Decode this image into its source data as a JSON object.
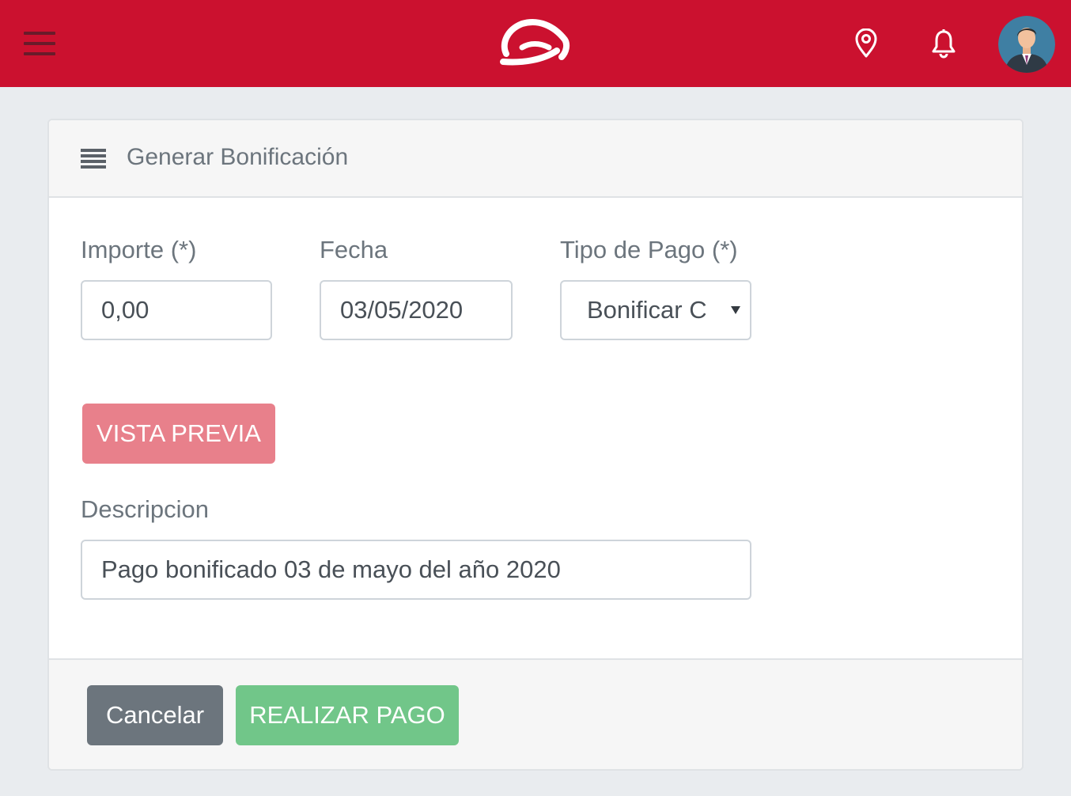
{
  "header": {
    "menu_icon": "hamburger-menu-icon",
    "logo_icon": "brand-logo",
    "location_icon": "location-pin-icon",
    "notifications_icon": "bell-icon",
    "avatar": "user-avatar",
    "colors": {
      "bar": "#cb112f"
    }
  },
  "card": {
    "title": "Generar Bonificación",
    "title_icon": "list-icon"
  },
  "form": {
    "importe": {
      "label": "Importe (*)",
      "value": "0,00"
    },
    "fecha": {
      "label": "Fecha",
      "value": "03/05/2020"
    },
    "tipo_pago": {
      "label": "Tipo de Pago (*)",
      "value": "Bonificar C"
    },
    "preview_button": "VISTA PREVIA",
    "descripcion": {
      "label": "Descripcion",
      "value": "Pago bonificado 03 de mayo del año 2020"
    }
  },
  "footer": {
    "cancel_label": "Cancelar",
    "pay_label": "REALIZAR PAGO",
    "colors": {
      "cancel": "#6c757d",
      "pay": "#71c689",
      "preview": "#e8808b"
    }
  }
}
